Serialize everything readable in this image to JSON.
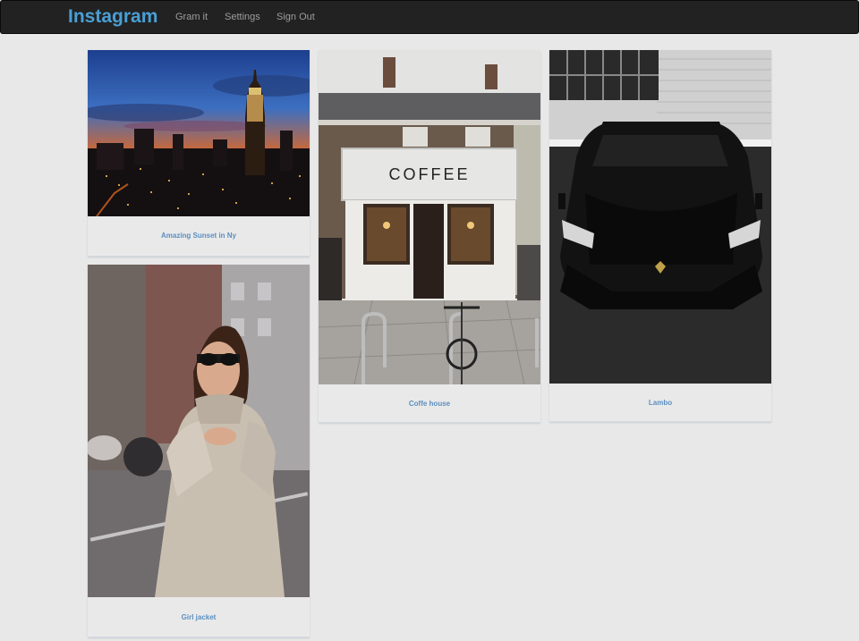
{
  "navbar": {
    "brand": "Instagram",
    "links": [
      {
        "label": "Gram it"
      },
      {
        "label": "Settings"
      },
      {
        "label": "Sign Out"
      }
    ]
  },
  "theme": {
    "brand_color": "#4a9fd5",
    "navbar_bg": "#222222",
    "page_bg": "#e8e8e8",
    "caption_color": "#5b8fc0"
  },
  "pins": [
    {
      "caption": "Amazing Sunset in Ny",
      "photo": "city-sunset-photo"
    },
    {
      "caption": "Coffe house",
      "photo": "coffee-shop-photo",
      "sign": "COFFEE"
    },
    {
      "caption": "Lambo",
      "photo": "black-car-photo"
    },
    {
      "caption": "Girl jacket",
      "photo": "woman-sweater-photo"
    }
  ]
}
